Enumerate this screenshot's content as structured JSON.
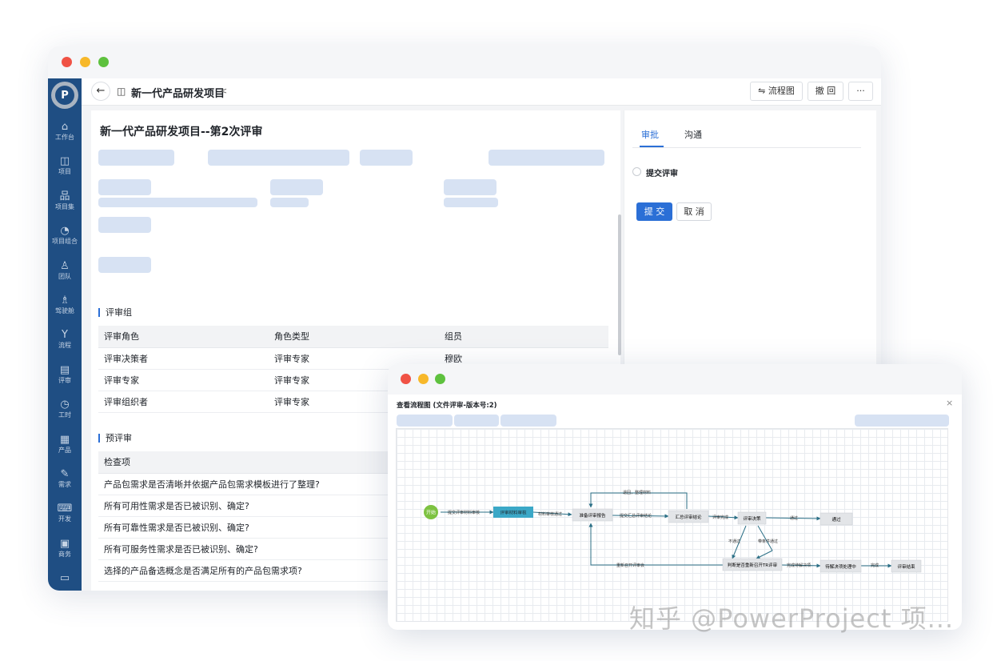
{
  "main_window": {
    "project_title": "新一代产品研发项目",
    "toolbar": {
      "flowchart_label": "流程图",
      "revoke_label": "撤 回",
      "more_label": "···"
    },
    "sidebar": {
      "items": [
        {
          "icon": "home-icon",
          "glyph": "⌂",
          "label": "工作台"
        },
        {
          "icon": "project-icon",
          "glyph": "◫",
          "label": "项目"
        },
        {
          "icon": "project-set-icon",
          "glyph": "品",
          "label": "项目集"
        },
        {
          "icon": "portfolio-icon",
          "glyph": "◔",
          "label": "项目组合"
        },
        {
          "icon": "team-icon",
          "glyph": "♙",
          "label": "团队"
        },
        {
          "icon": "cockpit-icon",
          "glyph": "♗",
          "label": "驾驶舱"
        },
        {
          "icon": "flow-icon",
          "glyph": "Y",
          "label": "流程"
        },
        {
          "icon": "review-icon",
          "glyph": "▤",
          "label": "评审"
        },
        {
          "icon": "time-icon",
          "glyph": "◷",
          "label": "工时"
        },
        {
          "icon": "product-icon",
          "glyph": "▦",
          "label": "产品"
        },
        {
          "icon": "requirement-icon",
          "glyph": "✎",
          "label": "需求"
        },
        {
          "icon": "dev-icon",
          "glyph": "⌨",
          "label": "开发"
        },
        {
          "icon": "business-icon",
          "glyph": "▣",
          "label": "商务"
        },
        {
          "icon": "more-icon",
          "glyph": "▭",
          "label": ""
        }
      ]
    },
    "content": {
      "page_title": "新一代产品研发项目--第2次评审",
      "review_group": {
        "section_title": "评审组",
        "columns": [
          "评审角色",
          "角色类型",
          "组员"
        ],
        "rows": [
          [
            "评审决策者",
            "评审专家",
            "穆欧"
          ],
          [
            "评审专家",
            "评审专家",
            ""
          ],
          [
            "评审组织者",
            "评审专家",
            ""
          ]
        ]
      },
      "pre_review": {
        "section_title": "预评审",
        "column": "检查项",
        "rows": [
          "产品包需求是否清晰并依据产品包需求模板进行了整理?",
          "所有可用性需求是否已被识别、确定?",
          "所有可靠性需求是否已被识别、确定?",
          "所有可服务性需求是否已被识别、确定?",
          "选择的产品备选概念是否满足所有的产品包需求项?"
        ]
      }
    },
    "right_panel": {
      "tabs": [
        "审批",
        "沟通"
      ],
      "active_tab": "审批",
      "radio_label": "提交评审",
      "submit_label": "提 交",
      "cancel_label": "取 消",
      "accent_color": "#2b6fd6"
    }
  },
  "flow_window": {
    "title": "查看流程图 (文件评审-版本号:2)",
    "close_label": "×",
    "nodes": {
      "start": "开始",
      "review_material": "评审材料审核",
      "prepare_report": "准备评审报告",
      "summary": "汇总评审结论",
      "decision": "评审决策",
      "pass": "通过",
      "judge": "判断是否重新召开TR评审",
      "pending": "待解决项处理中",
      "end": "评审结束"
    },
    "edge_labels": {
      "submit_material": "提交评审材料审核",
      "material_passed": "材料审核通过",
      "submit_summary": "提交汇总评审结论",
      "review_done": "评审完成",
      "passed": "通过",
      "return_material": "退回，整理材料",
      "not_passed": "不通过",
      "conditional_pass": "带条件通过",
      "resolve_done": "完成待解决项",
      "done": "完成",
      "reconvene": "重新召开评审会"
    }
  },
  "watermark": "知乎 @PowerProject 项..."
}
